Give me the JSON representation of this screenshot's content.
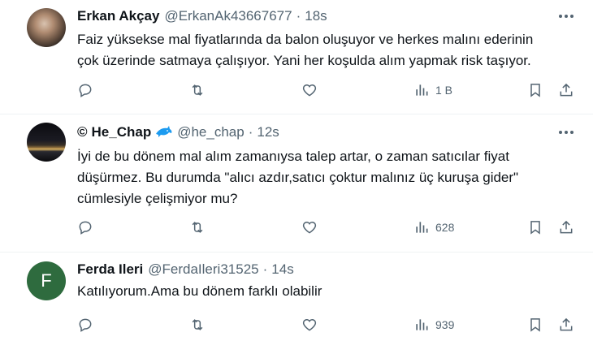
{
  "tweets": [
    {
      "name": "Erkan Akçay",
      "handle": "@ErkanAk43667677",
      "separator": "·",
      "time": "18s",
      "lines": [
        "Faiz yüksekse mal fiyatlarında da balon oluşuyor ve herkes malını ederinin",
        "çok üzerinde satmaya çalışıyor. Yani her koşulda alım yapmak risk taşıyor."
      ],
      "views": "1 B"
    },
    {
      "prefix": "©",
      "name": "He_Chap",
      "handle": "@he_chap",
      "separator": "·",
      "time": "12s",
      "lines": [
        "İyi de bu dönem mal alım zamanıysa talep artar, o zaman  satıcılar fiyat",
        "düşürmez. Bu durumda \"alıcı azdır,satıcı çoktur malınız üç kuruşa gider\"",
        "cümlesiyle çelişmiyor mu?"
      ],
      "views": "628"
    },
    {
      "avatar_letter": "F",
      "name": "Ferda Ileri",
      "handle": "@FerdaIleri31525",
      "separator": "·",
      "time": "14s",
      "lines": [
        "Katılıyorum.Ama bu dönem farklı olabilir"
      ],
      "views": "939"
    }
  ],
  "colors": {
    "text": "#0f1419",
    "secondary": "#536471",
    "divider": "#eff3f4",
    "avatar_f_bg": "#2e6b3e",
    "dolphin": "#1d9bf0"
  },
  "icons": [
    "reply-icon",
    "retweet-icon",
    "like-icon",
    "views-icon",
    "bookmark-icon",
    "share-icon",
    "more-icon",
    "dolphin-emoji-icon"
  ]
}
